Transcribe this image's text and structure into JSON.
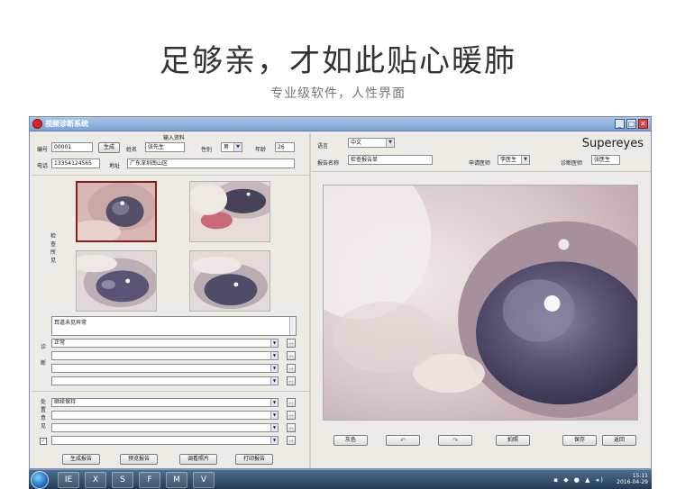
{
  "headline": "足够亲，才如此贴心暖肺",
  "subline": "专业级软件，人性界面",
  "window": {
    "title": "视频诊断系统",
    "controls": {
      "minimize": "_",
      "maximize": "□",
      "close": "✕"
    }
  },
  "form": {
    "section_title": "输入资料",
    "id_label": "编号",
    "id_value": "00001",
    "generate_button": "生成",
    "name_label": "姓名",
    "name_value": "张先生",
    "gender_label": "性别",
    "gender_value": "男",
    "age_label": "年龄",
    "age_value": "26",
    "phone_label": "电话",
    "phone_value": "13354124565",
    "address_label": "地址",
    "address_value": "广东深圳南山区"
  },
  "findings": {
    "side_label": [
      "检",
      "查",
      "所",
      "见"
    ],
    "memo_text": "耳道未见异常"
  },
  "diagnosis": {
    "side_label_top": "诊",
    "side_label_bottom": "断",
    "rows": [
      "正常",
      "",
      "",
      ""
    ]
  },
  "advice": {
    "side_label": [
      "处",
      "置",
      "意",
      "见"
    ],
    "rows": [
      "继续保持",
      "",
      "",
      ""
    ],
    "checkbox_mark": "✓"
  },
  "bottom_buttons": [
    "生成报告",
    "预览报告",
    "调看照片",
    "打印报告"
  ],
  "right_panel": {
    "language_label": "语言",
    "language_value": "中文",
    "logo": "Supereyes",
    "report_name_label": "报告名称",
    "report_name_value": "检查报告单",
    "applicant_label": "申请医师",
    "applicant_value": "李医生",
    "diagnostician_label": "诊断医师",
    "diagnostician_value": "张医生",
    "buttons": {
      "color": "灰色",
      "rotate_left": "↶",
      "rotate_right": "↷",
      "capture": "拍照",
      "save": "保存",
      "exit": "返回"
    }
  },
  "taskbar": {
    "time": "15:11",
    "date": "2016-04-29",
    "items": [
      "IE",
      "X",
      "S",
      "F",
      "M",
      "V"
    ]
  },
  "colors": {
    "window_border": "#7a8aa8",
    "titlebar": "#7aa2d2",
    "selected_thumb": "#8a1d16",
    "panel_bg": "#ecebe6"
  }
}
